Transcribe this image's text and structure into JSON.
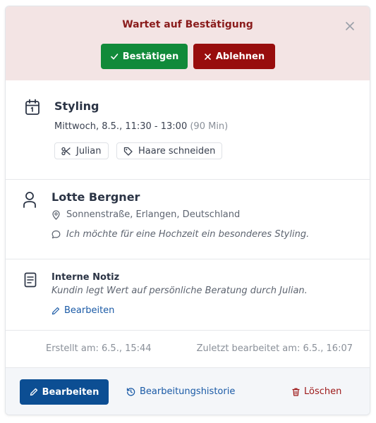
{
  "banner": {
    "title": "Wartet auf Bestätigung",
    "confirm_label": "Bestätigen",
    "reject_label": "Ablehnen",
    "bg_color": "#f3e4e4",
    "confirm_color": "#118a3a",
    "reject_color": "#980d0d"
  },
  "appointment": {
    "service": "Styling",
    "datetime": "Mittwoch, 8.5., 11:30 - 13:00",
    "duration": "(90 Min)",
    "tags": [
      {
        "label": "Julian",
        "icon": "scissors-icon"
      },
      {
        "label": "Haare schneiden",
        "icon": "tag-icon"
      }
    ]
  },
  "customer": {
    "name": "Lotte Bergner",
    "address": "Sonnenstraße, Erlangen, Deutschland",
    "comment": "Ich möchte für eine Hochzeit ein besonderes Styling."
  },
  "note": {
    "title": "Interne Notiz",
    "text": "Kundin legt Wert auf persönliche Beratung durch Julian.",
    "edit_label": "Bearbeiten"
  },
  "meta": {
    "created": "Erstellt am: 6.5., 15:44",
    "updated": "Zuletzt bearbeitet am: 6.5., 16:07"
  },
  "footer": {
    "edit_label": "Bearbeiten",
    "history_label": "Bearbeitungshistorie",
    "delete_label": "Löschen",
    "primary_color": "#0c4e93",
    "danger_color": "#9d1818"
  }
}
